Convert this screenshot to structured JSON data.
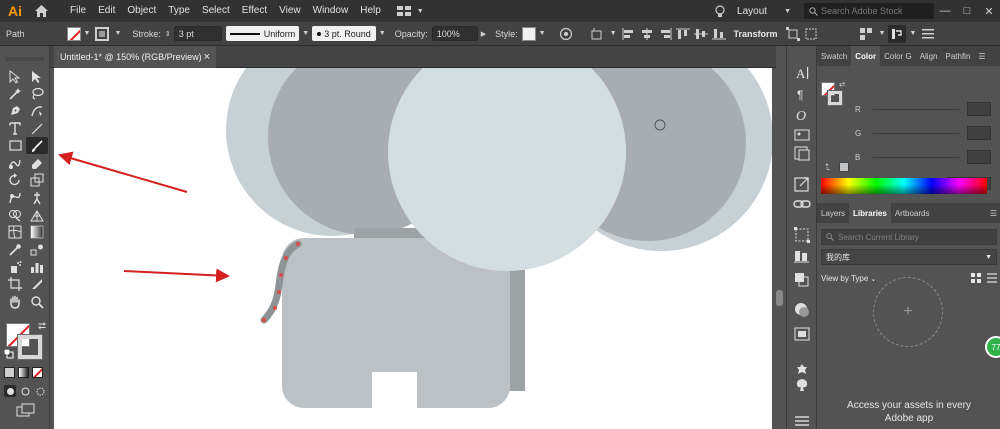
{
  "app": {
    "logo": "Ai"
  },
  "menu": [
    "File",
    "Edit",
    "Object",
    "Type",
    "Select",
    "Effect",
    "View",
    "Window",
    "Help"
  ],
  "menubar_right": {
    "layout_label": "Layout",
    "search_placeholder": "Search Adobe Stock",
    "win_min": "—",
    "win_max": "□",
    "win_close": "✕"
  },
  "control": {
    "selection": "Path",
    "stroke_label": "Stroke:",
    "stroke_weight": "3 pt",
    "profile": "Uniform",
    "brush": "3 pt. Round",
    "opacity_label": "Opacity:",
    "opacity": "100%",
    "style_label": "Style:",
    "transform": "Transform"
  },
  "document": {
    "tab_title": "Untitled-1* @ 150% (RGB/Preview)",
    "close": "×"
  },
  "panels": {
    "top_tabs": [
      {
        "label": "Swatch",
        "active": false
      },
      {
        "label": "Color",
        "active": true
      },
      {
        "label": "Color G",
        "active": false
      },
      {
        "label": "Align",
        "active": false
      },
      {
        "label": "Pathfin",
        "active": false
      }
    ],
    "color": {
      "r": "R",
      "g": "G",
      "b": "B",
      "hex": "#"
    },
    "bottom_tabs": [
      {
        "label": "Layers",
        "active": false
      },
      {
        "label": "Libraries",
        "active": true
      },
      {
        "label": "Artboards",
        "active": false
      }
    ],
    "libraries": {
      "search_placeholder": "Search Current Library",
      "library_name": "我的库",
      "view_by": "View by Type",
      "empty_plus": "+",
      "message_line1": "Access your assets in every",
      "message_line2": "Adobe app"
    }
  },
  "badge": "77",
  "colors": {
    "ear_outer": "#c7d0d5",
    "ear_inner": "#a8adb1",
    "head": "#d3dee2",
    "body": "#bbc1c4",
    "body_shadow": "#9da3a5",
    "tail": "#8e9496",
    "anchor": "#d94b4b",
    "arrow": "#d42020"
  }
}
